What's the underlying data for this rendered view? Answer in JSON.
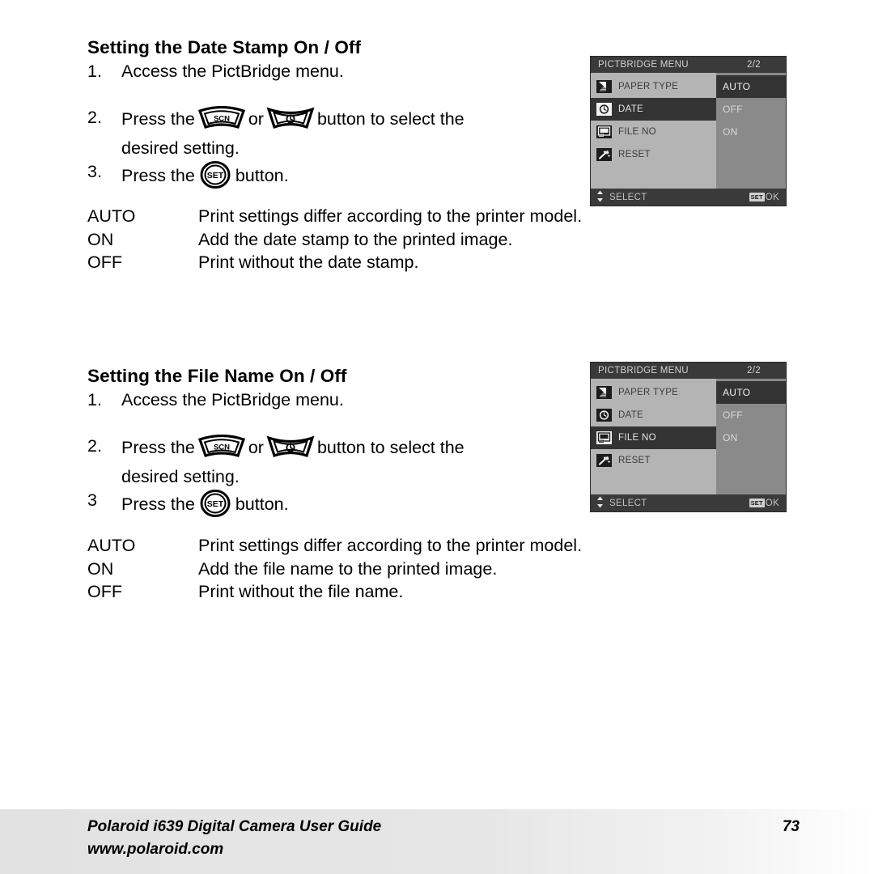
{
  "document": {
    "type": "user-guide-page",
    "page_number": "73"
  },
  "sections": [
    {
      "id": "date-stamp",
      "heading": "Setting the Date Stamp On / Off",
      "steps": [
        {
          "num": "1.",
          "text": "Access the PictBridge menu."
        },
        {
          "num": "2.",
          "text_before": "Press the",
          "icon_a": "scn-button-icon",
          "text_mid": "or",
          "icon_b": "self-timer-button-icon",
          "text_after": "button to select the",
          "continuation": "desired setting."
        },
        {
          "num": "3.",
          "text_before": "Press the",
          "icon_a": "set-button-icon",
          "text_after": "button."
        }
      ],
      "definitions": [
        {
          "term": "AUTO",
          "desc": "Print settings differ according to the printer model."
        },
        {
          "term": "ON",
          "desc": "Add the date stamp to the printed image."
        },
        {
          "term": "OFF",
          "desc": "Print without the date stamp."
        }
      ]
    },
    {
      "id": "file-name",
      "heading": "Setting the File Name On / Off",
      "steps": [
        {
          "num": "1.",
          "text": "Access the PictBridge menu."
        },
        {
          "num": "2.",
          "text_before": "Press the",
          "icon_a": "scn-button-icon",
          "text_mid": "or",
          "icon_b": "self-timer-button-icon",
          "text_after": "button to select the",
          "continuation": "desired setting."
        },
        {
          "num": "3",
          "text_before": "Press the",
          "icon_a": "set-button-icon",
          "text_after": "button."
        }
      ],
      "definitions": [
        {
          "term": "AUTO",
          "desc": "Print settings differ according to the printer model."
        },
        {
          "term": "ON",
          "desc": "Add the file name to the printed image."
        },
        {
          "term": "OFF",
          "desc": "Print without the file name."
        }
      ]
    }
  ],
  "lcd_screens": [
    {
      "id": "lcd-date",
      "title": "PICTBRIDGE MENU",
      "page_indicator": "2/2",
      "menu_items": [
        {
          "label": "PAPER TYPE",
          "icon": "paper-type-icon",
          "selected": false
        },
        {
          "label": "DATE",
          "icon": "clock-icon",
          "selected": true
        },
        {
          "label": "FILE NO",
          "icon": "file-number-icon",
          "selected": false
        },
        {
          "label": "RESET",
          "icon": "wrench-reset-icon",
          "selected": false
        }
      ],
      "options": [
        {
          "label": "AUTO",
          "selected": true
        },
        {
          "label": "OFF",
          "selected": false
        },
        {
          "label": "ON",
          "selected": false
        }
      ],
      "footer": {
        "select_label": "SELECT",
        "set_badge": "SET",
        "ok_label": "OK"
      }
    },
    {
      "id": "lcd-file",
      "title": "PICTBRIDGE MENU",
      "page_indicator": "2/2",
      "menu_items": [
        {
          "label": "PAPER TYPE",
          "icon": "paper-type-icon",
          "selected": false
        },
        {
          "label": "DATE",
          "icon": "clock-icon",
          "selected": false
        },
        {
          "label": "FILE NO",
          "icon": "file-number-icon",
          "selected": true
        },
        {
          "label": "RESET",
          "icon": "wrench-reset-icon",
          "selected": false
        }
      ],
      "options": [
        {
          "label": "AUTO",
          "selected": true
        },
        {
          "label": "OFF",
          "selected": false
        },
        {
          "label": "ON",
          "selected": false
        }
      ],
      "footer": {
        "select_label": "SELECT",
        "set_badge": "SET",
        "ok_label": "OK"
      }
    }
  ],
  "footer": {
    "line1": "Polaroid i639 Digital Camera User Guide",
    "line2": "www.polaroid.com",
    "page_number": "73"
  },
  "icons": {
    "scn_label": "SCN",
    "set_label": "SET"
  },
  "colors": {
    "page_background": "#ffffff",
    "text": "#000000",
    "lcd_header": "#3a3a3a",
    "lcd_left_panel": "#b4b4b4",
    "lcd_right_panel": "#8a8a8a",
    "lcd_highlight": "#333333",
    "footer_band": "#e2e2e2"
  }
}
